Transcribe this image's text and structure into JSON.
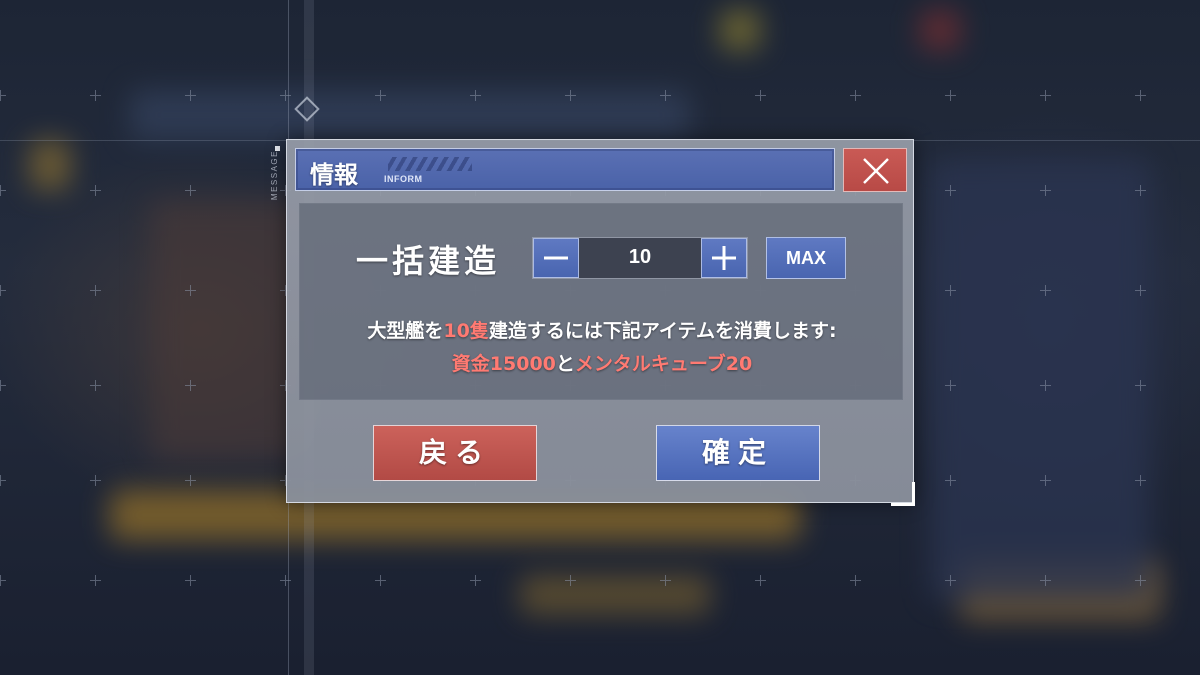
{
  "dialog": {
    "title": "情報",
    "title_sub": "INFORM",
    "side_label": "MESSAGE",
    "close_icon": "close-icon",
    "batch": {
      "label": "一括建造",
      "quantity": "10",
      "minus_icon": "minus-icon",
      "plus_icon": "plus-icon",
      "max_label": "MAX"
    },
    "message": {
      "line1": {
        "prefix": "大型艦を",
        "count": "10隻",
        "suffix": "建造するには下記アイテムを消費します:"
      },
      "line2": {
        "funds": "資金15000",
        "connector": "と",
        "cubes": "メンタルキューブ20"
      }
    },
    "buttons": {
      "back": "戻る",
      "confirm": "確定"
    }
  },
  "colors": {
    "accent_blue": "#4a62a8",
    "accent_red": "#b84a46",
    "highlight_text": "#ff7a72"
  }
}
